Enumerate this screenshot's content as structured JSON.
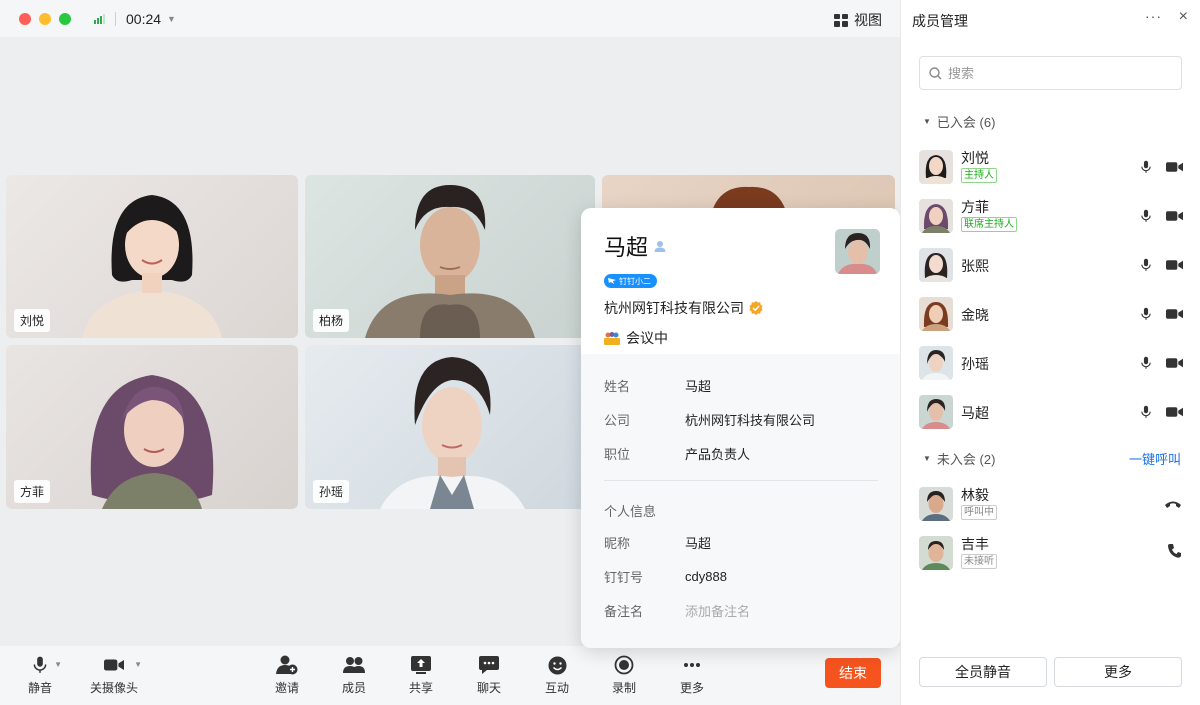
{
  "titlebar": {
    "timer": "00:24",
    "view_label": "视图"
  },
  "tiles": [
    {
      "name": "刘悦"
    },
    {
      "name": "柏杨"
    },
    {
      "name": "方菲"
    },
    {
      "name": "孙瑶"
    }
  ],
  "toolbar": {
    "mute": "静音",
    "camera_off": "关摄像头",
    "invite": "邀请",
    "members": "成员",
    "share": "共享",
    "chat": "聊天",
    "interact": "互动",
    "record": "录制",
    "more": "更多",
    "end": "结束"
  },
  "profile_card": {
    "name": "马超",
    "badge": "钉钉小二",
    "company": "杭州网钉科技有限公司",
    "status": "会议中",
    "fields": [
      {
        "key": "姓名",
        "value": "马超"
      },
      {
        "key": "公司",
        "value": "杭州网钉科技有限公司"
      },
      {
        "key": "职位",
        "value": "产品负责人"
      }
    ],
    "personal_title": "个人信息",
    "personal_fields": [
      {
        "key": "昵称",
        "value": "马超"
      },
      {
        "key": "钉钉号",
        "value": "cdy888"
      },
      {
        "key": "备注名",
        "value": "添加备注名"
      }
    ]
  },
  "panel": {
    "title": "成员管理",
    "more": "···",
    "close": "×",
    "search_placeholder": "搜索",
    "joined_label": "已入会 (6)",
    "not_joined_label": "未入会 (2)",
    "call_all": "一键呼叫",
    "joined": [
      {
        "name": "刘悦",
        "tag": "主持人"
      },
      {
        "name": "方菲",
        "tag": "联席主持人"
      },
      {
        "name": "张熙",
        "tag": ""
      },
      {
        "name": "金晓",
        "tag": ""
      },
      {
        "name": "孙瑶",
        "tag": ""
      },
      {
        "name": "马超",
        "tag": ""
      }
    ],
    "not_joined": [
      {
        "name": "林毅",
        "tag": "呼叫中"
      },
      {
        "name": "吉丰",
        "tag": "未接听"
      }
    ],
    "mute_all": "全员静音",
    "more_btn": "更多"
  },
  "colors": {
    "end_button": "#f5541f",
    "link": "#1a73e8",
    "host_tag": "#1aad19"
  }
}
